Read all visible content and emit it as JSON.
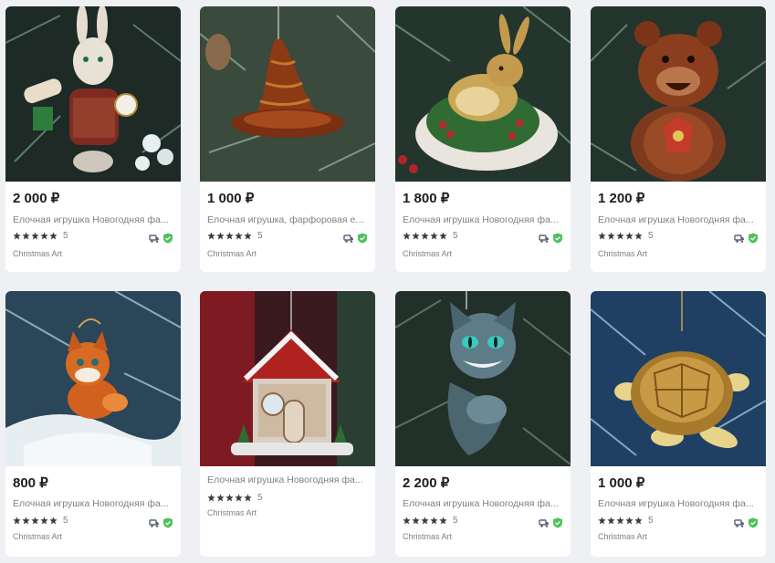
{
  "products": [
    {
      "price": "2 000 ₽",
      "title": "Елочная игрушка Новогодняя фа...",
      "rating": "5",
      "seller": "Christmas Art",
      "image": "rabbit-ornament"
    },
    {
      "price": "1 000 ₽",
      "title": "Елочная игрушка, фарфоровая ел...",
      "rating": "5",
      "seller": "Christmas Art",
      "image": "sorting-hat-ornament"
    },
    {
      "price": "1 800 ₽",
      "title": "Елочная игрушка Новогодняя фа...",
      "rating": "5",
      "seller": "Christmas Art",
      "image": "bunny-wreath-ornament"
    },
    {
      "price": "1 200 ₽",
      "title": "Елочная игрушка Новогодняя фа...",
      "rating": "5",
      "seller": "Christmas Art",
      "image": "bear-ornament"
    },
    {
      "price": "800 ₽",
      "title": "Елочная игрушка Новогодняя фа...",
      "rating": "5",
      "seller": "Christmas Art",
      "image": "fox-ornament"
    },
    {
      "price": "",
      "title": "Елочная игрушка Новогодняя фа...",
      "rating": "5",
      "seller": "Christmas Art",
      "image": "house-ornament"
    },
    {
      "price": "2 200 ₽",
      "title": "Елочная игрушка Новогодняя фа...",
      "rating": "5",
      "seller": "Christmas Art",
      "image": "cheshire-cat-ornament"
    },
    {
      "price": "1 000 ₽",
      "title": "Елочная игрушка Новогодняя фа...",
      "rating": "5",
      "seller": "Christmas Art",
      "image": "turtle-ornament"
    }
  ],
  "colors": {
    "star": "#3c3c3c",
    "shield": "#4cc25a",
    "delivery": "#5a6478",
    "price": "#1e1e1e",
    "muted": "#7b8189"
  }
}
